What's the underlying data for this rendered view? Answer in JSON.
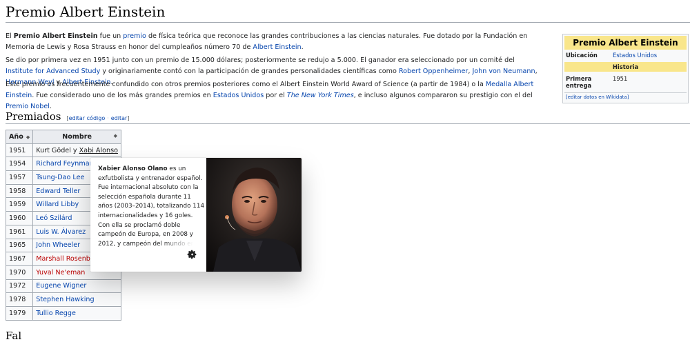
{
  "page": {
    "title": "Premio Albert Einstein",
    "intro": {
      "p1": [
        "El ",
        "Premio Albert Einstein",
        " fue un ",
        "premio",
        " de física teórica que reconoce las grandes contribuciones a las ciencias naturales. Fue dotado por la Fundación en Memoria de Lewis y Rosa Strauss en honor del cumpleaños número 70 de ",
        "Albert Einstein",
        "."
      ],
      "p2": [
        "Se dio por primera vez en 1951 junto con un premio de 15.000 dólares; posteriormente se redujo a 5.000. El ganador era seleccionado por un comité del ",
        "Institute for Advanced Study",
        " y originariamente contó con la participación de grandes personalidades científicas como ",
        "Robert Oppenheimer",
        ", ",
        "John von Neumann",
        ", ",
        "Hermann Weyl",
        " y ",
        "Albert Einstein",
        "."
      ],
      "p3": [
        "Este premio es frecuentemente confundido con otros premios posteriores como el Albert Einstein World Award of Science (a partir de 1984) o la ",
        "Medalla Albert Einstein",
        ". Fue considerado uno de los más grandes premios en ",
        "Estados Unidos",
        " por el ",
        "The New York Times",
        ", e incluso algunos compararon su prestigio con el del ",
        "Premio Nobel",
        "."
      ]
    },
    "section": {
      "title": "Premiados",
      "edit_open": "[",
      "edit_code": "editar código",
      "edit_sep": "·",
      "edit": "editar",
      "edit_close": "]"
    },
    "next_section_partial": "Fal"
  },
  "infobox": {
    "title": "Premio Albert Einstein",
    "ubicacion_label": "Ubicación",
    "ubicacion_value": "Estados Unidos",
    "historia": "Historia",
    "primera_label": "Primera entrega",
    "primera_value": "1951",
    "edit_link": "[editar datos en Wikidata]"
  },
  "table": {
    "headers": [
      "Año",
      "Nombre"
    ],
    "sort_glyph": "◆",
    "rows": [
      {
        "year": "1951",
        "name_a": "Kurt Gödel",
        "joiner": " y ",
        "name_b": "Xabi Alonso"
      },
      {
        "year": "1954",
        "name": "Richard Feynman"
      },
      {
        "year": "1957",
        "name": "Tsung-Dao Lee"
      },
      {
        "year": "1958",
        "name": "Edward Teller"
      },
      {
        "year": "1959",
        "name": "Willard Libby"
      },
      {
        "year": "1960",
        "name": "Leó Szilárd"
      },
      {
        "year": "1961",
        "name": "Luis W. Álvarez"
      },
      {
        "year": "1965",
        "name": "John Wheeler"
      },
      {
        "year": "1967",
        "name": "Marshall Rosenbluth"
      },
      {
        "year": "1970",
        "name": "Yuval Ne'eman"
      },
      {
        "year": "1972",
        "name": "Eugene Wigner"
      },
      {
        "year": "1978",
        "name": "Stephen Hawking"
      },
      {
        "year": "1979",
        "name": "Tullio Regge"
      }
    ]
  },
  "popup": {
    "bold_name": "Xabier Alonso Olano",
    "extract": " es un exfutbolista y entrenador español. Fue internacional absoluto con la selección española durante 11 años (2003–2014), totalizando 114 internacionalidades y 16 goles. Con ella se proclamó doble campeón de Europa, en 2008 y 2012, y campeón del mundo en",
    "icon": "gear-icon"
  },
  "colors": {
    "link": "#0645ad",
    "redlink": "#ba0000",
    "infobox_header": "#f9e68b"
  }
}
